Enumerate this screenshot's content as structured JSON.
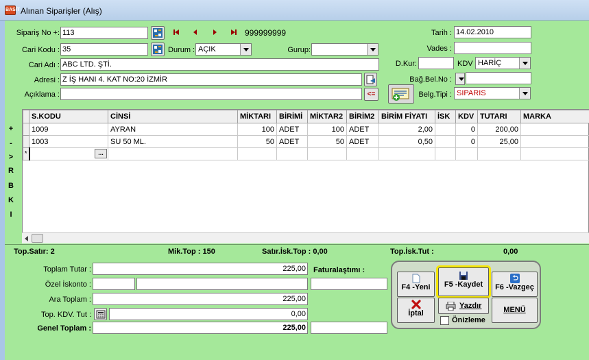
{
  "window": {
    "title": "Alınan Siparişler (Alış)",
    "icon": "app-icon-basit",
    "icon_text": "BASİT"
  },
  "header": {
    "siparis_no_label": "Sipariş No +:",
    "siparis_no_value": "113",
    "record_counter": "999999999",
    "cari_kodu_label": "Cari Kodu :",
    "cari_kodu_value": "35",
    "durum_label": "Durum :",
    "durum_value": "AÇIK",
    "gurup_label": "Gurup:",
    "gurup_value": "",
    "cari_adi_label": "Cari Adı :",
    "cari_adi_value": "ABC LTD. ŞTİ.",
    "adresi_label": "Adresi :",
    "adresi_value": "Z İŞ HANI 4. KAT NO:20 İZMİR",
    "aciklama_label": "Açıklama :",
    "aciklama_value": "",
    "copy_btn_label": "<=",
    "tarih_label": "Tarih :",
    "tarih_value": "14.02.2010",
    "vades_label": "Vades :",
    "vades_value": "",
    "dkur_label": "D.Kur:",
    "dkur_value": "",
    "kdv_label": "KDV",
    "kdv_value": "HARİÇ",
    "bag_bel_no_label": "Bağ.Bel.No :",
    "bag_bel_no_value": "",
    "belg_tipi_label": "Belg.Tipi :",
    "belg_tipi_value": "SIPARIS"
  },
  "side_labels": [
    "+",
    "-",
    ">",
    "R",
    "B",
    "K",
    "I"
  ],
  "grid": {
    "columns": [
      "S.KODU",
      "CİNSİ",
      "MİKTARI",
      "BİRİMİ",
      "MİKTAR2",
      "BİRİM2",
      "BİRİM FİYATI",
      "İSK",
      "KDV",
      "TUTARI",
      "MARKA"
    ],
    "rows": [
      [
        "1009",
        "AYRAN",
        "100",
        "ADET",
        "100",
        "ADET",
        "2,00",
        "",
        "0",
        "200,00",
        ""
      ],
      [
        "1003",
        "SU 50 ML.",
        "50",
        "ADET",
        "50",
        "ADET",
        "0,50",
        "",
        "0",
        "25,00",
        ""
      ]
    ],
    "new_row_marker": "*",
    "lookup_btn": "..."
  },
  "stats": {
    "top_satir": "Top.Satır: 2",
    "mik_top": "Mik.Top : 150",
    "satir_isk_top": "Satır.İsk.Top : 0,00",
    "top_isk_tut_label": "Top.İsk.Tut :",
    "top_isk_tut_value": "0,00"
  },
  "totals": {
    "toplam_tutar_label": "Toplam Tutar :",
    "toplam_tutar_value": "225,00",
    "ozel_iskonto_label": "Özel İskonto :",
    "ozel_iskonto_value1": "",
    "ozel_iskonto_value2": "",
    "ara_toplam_label": "Ara Toplam :",
    "ara_toplam_value": "225,00",
    "top_kdv_tut_label": "Top. KDV. Tut :",
    "top_kdv_tut_value": "0,00",
    "genel_toplam_label": "Genel Toplam :",
    "genel_toplam_value": "225,00",
    "faturalastimi_label": "Faturalaştımı :",
    "faturalastimi_value": ""
  },
  "actions": {
    "yeni": "F4 -Yeni",
    "kaydet": "F5 -Kaydet",
    "vazgec": "F6 -Vazgeç",
    "iptal": "İptal",
    "yazdir": "Yazdır",
    "menu": "MENÜ",
    "onizleme": "Önizleme"
  },
  "colors": {
    "form_bg": "#a5e89a",
    "highlight": "#f5e60a",
    "red_text": "#c00000"
  }
}
